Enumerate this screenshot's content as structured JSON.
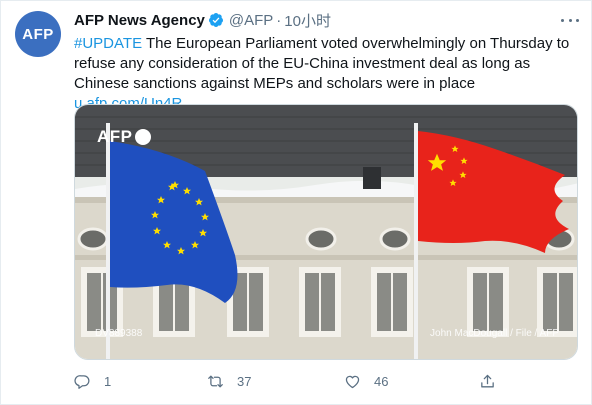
{
  "tweet": {
    "avatar_text": "AFP",
    "author_name": "AFP News Agency",
    "author_handle": "@AFP",
    "separator": "·",
    "timestamp": "10小时",
    "hashtag": "#UPDATE",
    "body": " The European Parliament voted overwhelmingly on Thursday to refuse any consideration of the EU-China investment deal as long as Chinese sanctions against MEPs and scholars were in place ",
    "link": "u.afp.com/Un4R"
  },
  "media": {
    "watermark": "AFP",
    "photo_id": "DV889388",
    "credit": "John MacDougall / File / AFP"
  },
  "actions": {
    "reply_count": "1",
    "retweet_count": "37",
    "like_count": "46"
  },
  "colors": {
    "link": "#1b95e0",
    "secondary_text": "#5b7083",
    "verified": "#1da1f2",
    "eu_blue": "#1f4fbf",
    "china_red": "#e8231b",
    "star_yellow": "#ffde00"
  }
}
